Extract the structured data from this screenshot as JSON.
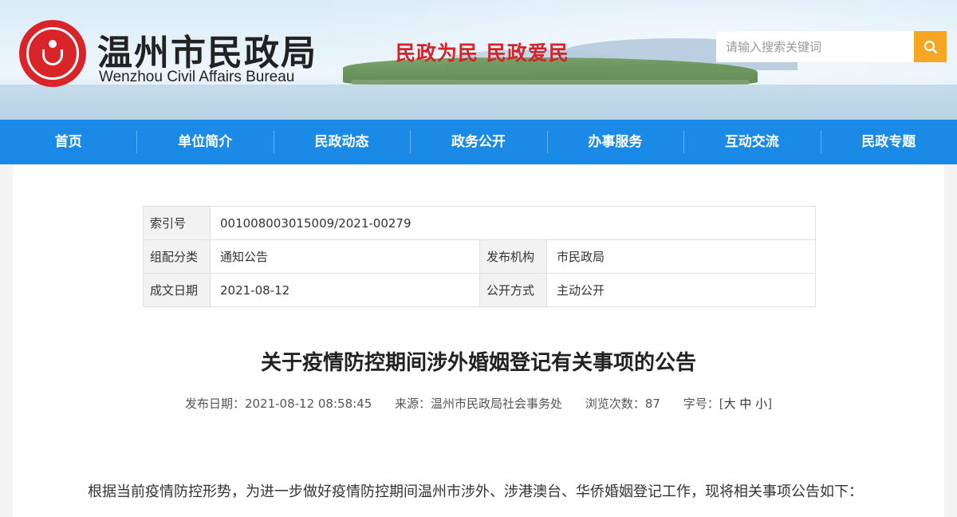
{
  "header": {
    "site_title": "温州市民政局",
    "site_subtitle": "Wenzhou Civil Affairs Bureau",
    "slogan": "民政为民  民政爱民",
    "search_placeholder": "请输入搜索关键词",
    "search_icon": "search-icon",
    "colors": {
      "logo_red": "#d9252a",
      "slogan_red": "#d4232b",
      "search_btn": "#f5a623"
    }
  },
  "nav": {
    "items": [
      "首页",
      "单位简介",
      "民政动态",
      "政务公开",
      "办事服务",
      "互动交流",
      "民政专题"
    ],
    "color": "#1a8ae6"
  },
  "meta": {
    "index_label": "索引号",
    "index_value": "001008003015009/2021-00279",
    "category_label": "组配分类",
    "category_value": "通知公告",
    "publisher_label": "发布机构",
    "publisher_value": "市民政局",
    "date_label": "成文日期",
    "date_value": "2021-08-12",
    "open_label": "公开方式",
    "open_value": "主动公开"
  },
  "article": {
    "title": "关于疫情防控期间涉外婚姻登记有关事项的公告",
    "publish_date": "发布日期：2021-08-12 08:58:45",
    "source": "来源：温州市民政局社会事务处",
    "views": "浏览次数：87",
    "font_size_label": "字号：",
    "font_size_options": [
      "大",
      "中",
      "小"
    ],
    "body_first_line": "根据当前疫情防控形势，为进一步做好疫情防控期间温州市涉外、涉港澳台、华侨婚姻登记工作，现将相关事项公告如下："
  }
}
